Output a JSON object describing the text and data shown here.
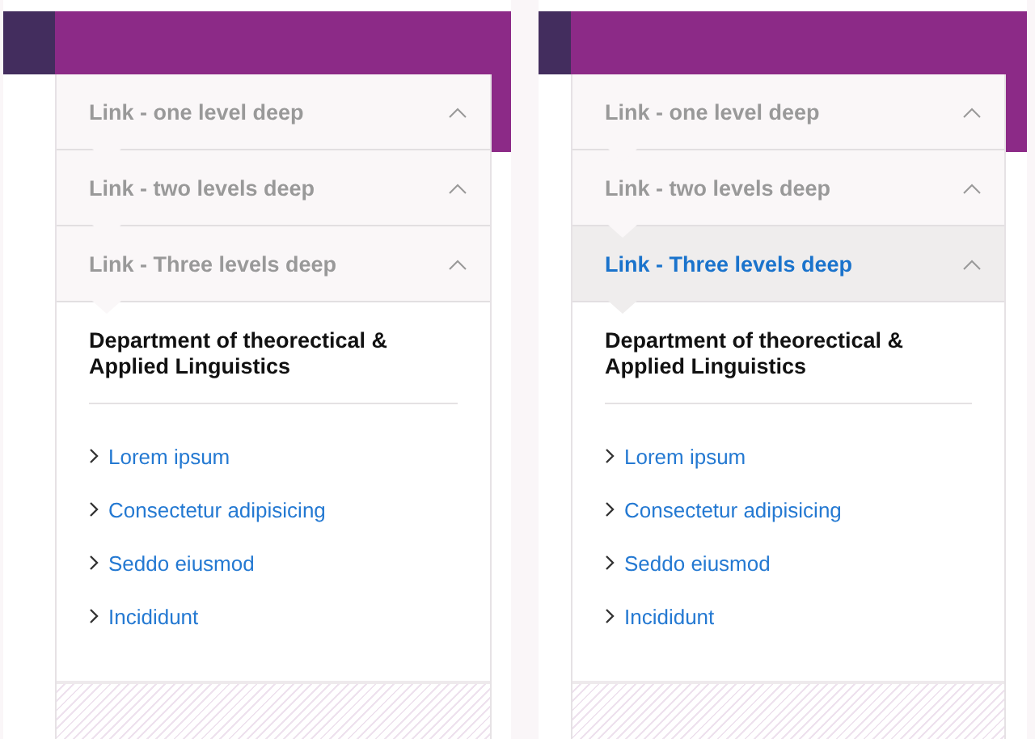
{
  "panels": [
    {
      "items": [
        {
          "label": "Link - one level deep",
          "selected": false
        },
        {
          "label": "Link - two levels deep",
          "selected": false
        },
        {
          "label": "Link - Three levels deep",
          "selected": false
        }
      ],
      "heading": "Department of theorectical & Applied Linguistics",
      "links": [
        "Lorem ipsum",
        "Consectetur adipisicing",
        "Seddo eiusmod",
        "Incididunt"
      ]
    },
    {
      "items": [
        {
          "label": "Link - one level deep",
          "selected": false
        },
        {
          "label": "Link - two levels deep",
          "selected": false
        },
        {
          "label": "Link - Three levels deep",
          "selected": true
        }
      ],
      "heading": "Department of theorectical & Applied Linguistics",
      "links": [
        "Lorem ipsum",
        "Consectetur adipisicing",
        "Seddo eiusmod",
        "Incididunt"
      ]
    }
  ]
}
